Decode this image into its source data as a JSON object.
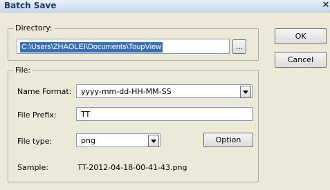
{
  "window": {
    "title": "Batch Save",
    "close_glyph": "✕"
  },
  "directory": {
    "label": "Directory:",
    "path": "C:\\Users\\ZHAOLEI\\Documents\\ToupView",
    "browse_label": "..."
  },
  "file": {
    "label": "File:",
    "name_format": {
      "label": "Name Format:",
      "value": "yyyy-mm-dd-HH-MM-SS"
    },
    "file_prefix": {
      "label": "File Prefix:",
      "value": "TT"
    },
    "file_type": {
      "label": "File type:",
      "value": "png"
    },
    "option_label": "Option",
    "sample": {
      "label": "Sample:",
      "value": "TT-2012-04-18-00-41-43.png"
    }
  },
  "buttons": {
    "ok": "OK",
    "cancel": "Cancel"
  },
  "icons": {
    "close": "close-icon",
    "dropdown": "chevron-down-icon"
  }
}
